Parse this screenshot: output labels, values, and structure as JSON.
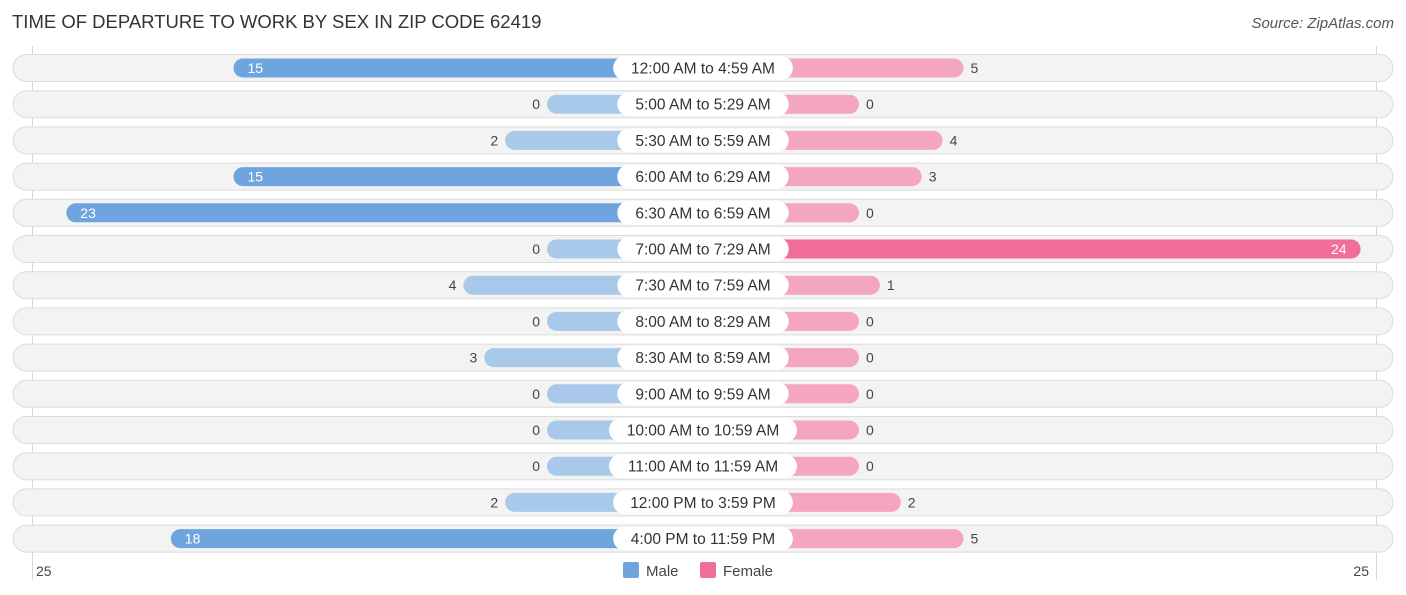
{
  "header": {
    "title": "TIME OF DEPARTURE TO WORK BY SEX IN ZIP CODE 62419",
    "source": "Source: ZipAtlas.com"
  },
  "colors": {
    "male": "#6fa5de",
    "male_light": "#a9c9eb",
    "female": "#f06e97",
    "female_light": "#f5a6bf"
  },
  "chart_data": {
    "type": "bar",
    "orientation": "horizontal-diverging",
    "title": "TIME OF DEPARTURE TO WORK BY SEX IN ZIP CODE 62419",
    "categories": [
      "12:00 AM to 4:59 AM",
      "5:00 AM to 5:29 AM",
      "5:30 AM to 5:59 AM",
      "6:00 AM to 6:29 AM",
      "6:30 AM to 6:59 AM",
      "7:00 AM to 7:29 AM",
      "7:30 AM to 7:59 AM",
      "8:00 AM to 8:29 AM",
      "8:30 AM to 8:59 AM",
      "9:00 AM to 9:59 AM",
      "10:00 AM to 10:59 AM",
      "11:00 AM to 11:59 AM",
      "12:00 PM to 3:59 PM",
      "4:00 PM to 11:59 PM"
    ],
    "series": [
      {
        "name": "Male",
        "values": [
          15,
          0,
          2,
          15,
          23,
          0,
          4,
          0,
          3,
          0,
          0,
          0,
          2,
          18
        ]
      },
      {
        "name": "Female",
        "values": [
          5,
          0,
          4,
          3,
          0,
          24,
          1,
          0,
          0,
          0,
          0,
          0,
          2,
          5
        ]
      }
    ],
    "axis": {
      "left_label": "25",
      "right_label": "25",
      "max": 25
    },
    "legend": {
      "items": [
        "Male",
        "Female"
      ],
      "placement": "bottom-center"
    },
    "xlabel": "",
    "ylabel": ""
  }
}
